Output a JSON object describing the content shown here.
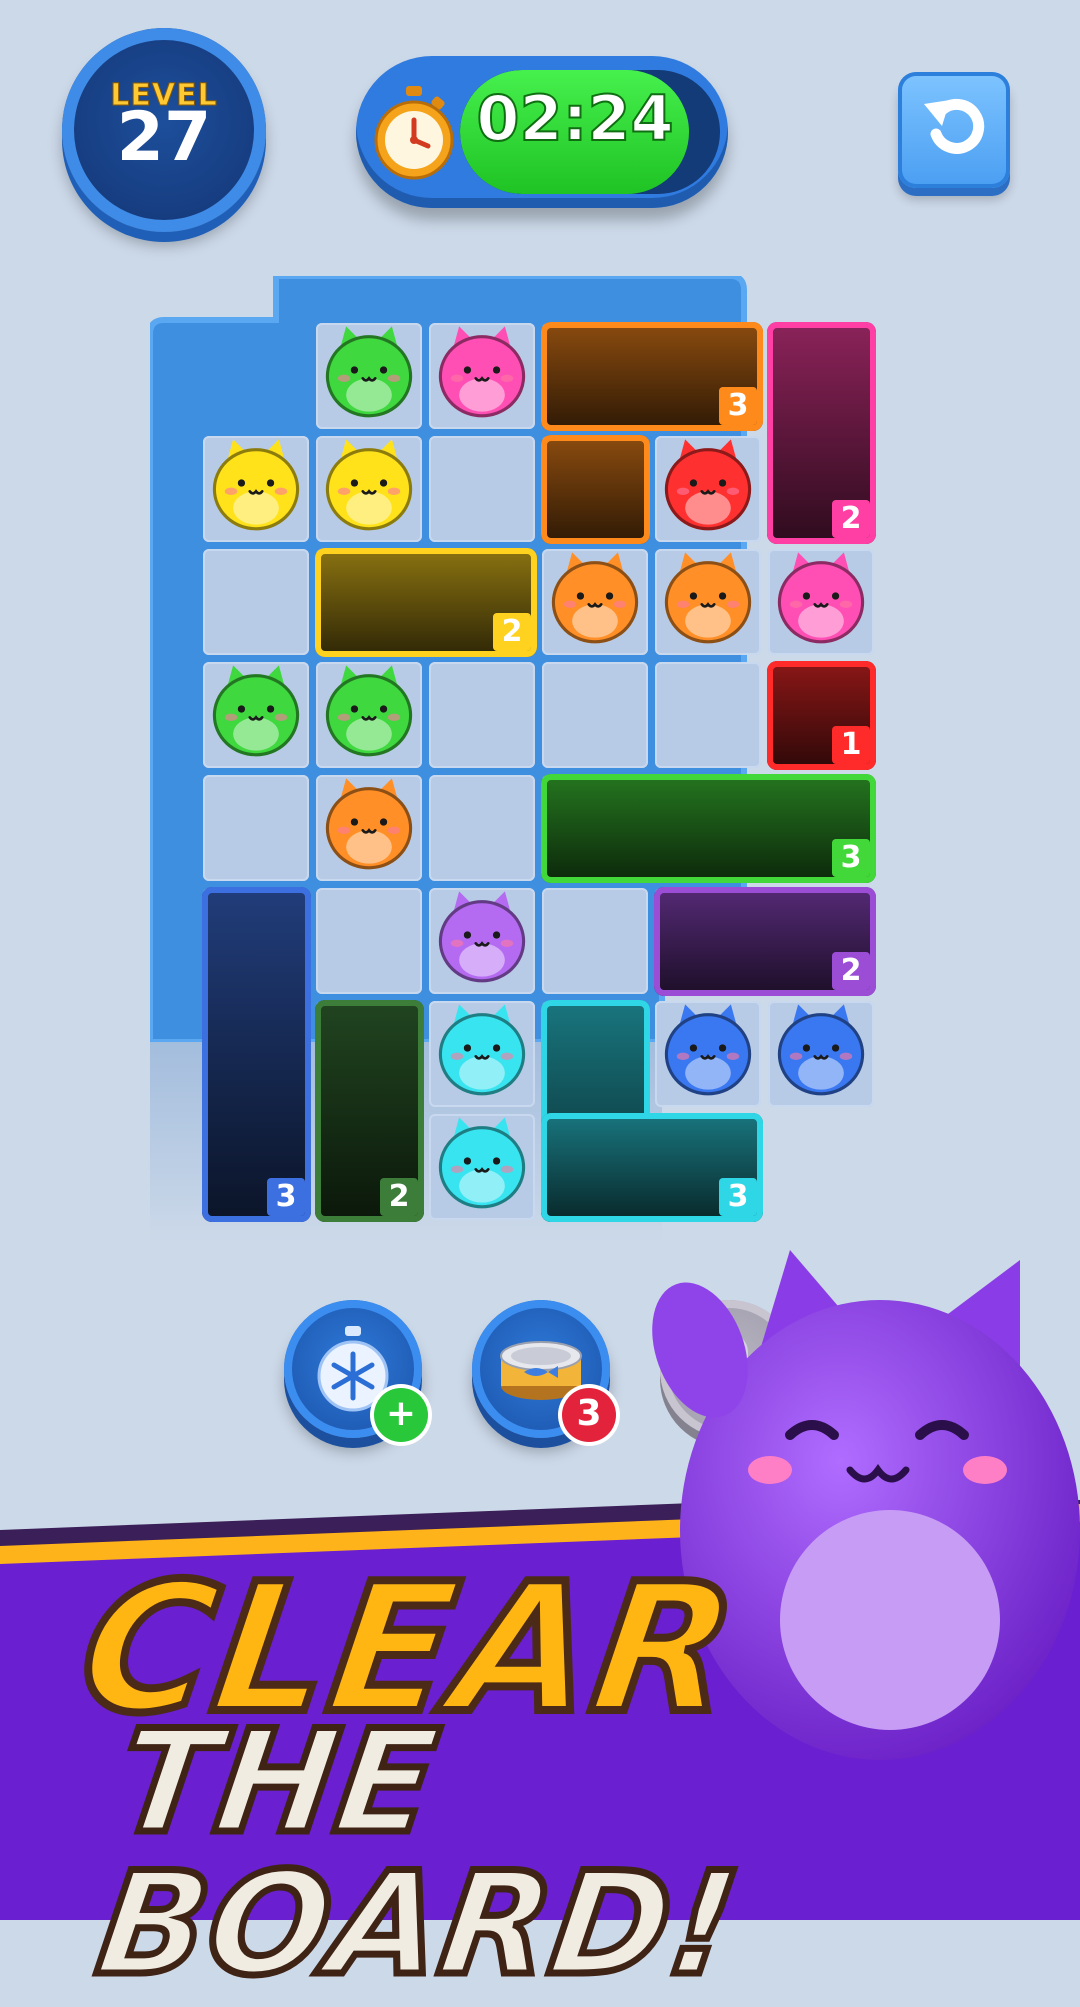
{
  "hud": {
    "level_label": "LEVEL",
    "level_number": "27",
    "timer_text": "02:24",
    "timer_remaining_fraction": 0.88,
    "undo_icon": "undo-arrow-icon",
    "stopwatch_icon": "stopwatch-icon"
  },
  "board": {
    "boxes": [
      {
        "name": "orange-box",
        "color": "#ff8a1c",
        "count": "3"
      },
      {
        "name": "pink-box",
        "color": "#ff3fa3",
        "count": "2"
      },
      {
        "name": "yellow-box",
        "color": "#ffd21f",
        "count": "2"
      },
      {
        "name": "red-box",
        "color": "#ff2a2a",
        "count": "1"
      },
      {
        "name": "green-box",
        "color": "#43d83a",
        "count": "3"
      },
      {
        "name": "purple-box",
        "color": "#9b4dd6",
        "count": "2"
      },
      {
        "name": "blue-box",
        "color": "#3c6fe0",
        "count": "3"
      },
      {
        "name": "dark-green-box",
        "color": "#3c7d3a",
        "count": "2"
      },
      {
        "name": "cyan-box",
        "color": "#2ed6e6",
        "count": "3"
      }
    ],
    "cat_colors": {
      "green": "#3fd83f",
      "pink": "#ff4fb4",
      "yellow": "#ffe21a",
      "red": "#ff3030",
      "orange": "#ff8f26",
      "purple": "#b46bf2",
      "cyan": "#38e4f0",
      "blue": "#3a78f2"
    }
  },
  "powerups": [
    {
      "name": "freeze-timer",
      "icon": "snowflake-stopwatch-icon",
      "badge": "+",
      "badge_color": "#28c83a"
    },
    {
      "name": "cat-food",
      "icon": "fish-can-icon",
      "badge": "3",
      "badge_color": "#e3223b"
    },
    {
      "name": "locked",
      "icon": "lock-icon"
    }
  ],
  "banner": {
    "line1": "CLEAR",
    "line2": "THE BOARD!",
    "mascot": "purple-cat-mascot"
  }
}
